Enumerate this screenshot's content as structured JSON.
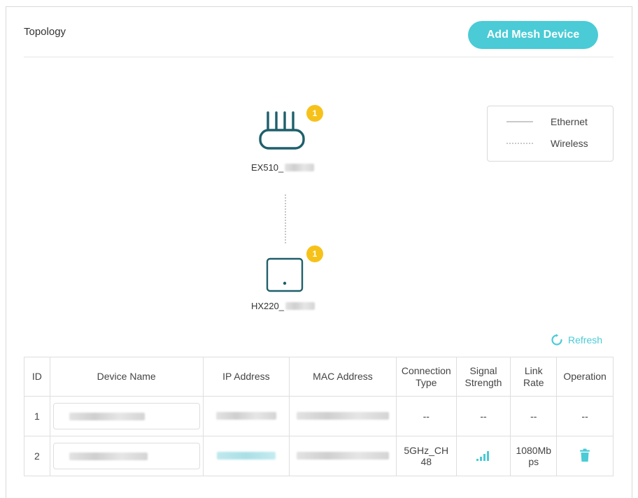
{
  "header": {
    "title": "Topology",
    "add_button": "Add Mesh Device"
  },
  "topology": {
    "main_router": {
      "label": "EX510_",
      "badge": "1"
    },
    "satellite": {
      "label": "HX220_",
      "badge": "1"
    },
    "connection": "wireless"
  },
  "legend": {
    "ethernet": "Ethernet",
    "wireless": "Wireless"
  },
  "refresh_label": "Refresh",
  "table": {
    "headers": {
      "id": "ID",
      "device_name": "Device Name",
      "ip": "IP Address",
      "mac": "MAC Address",
      "conn_type_1": "Connection",
      "conn_type_2": "Type",
      "signal_1": "Signal",
      "signal_2": "Strength",
      "link_1": "Link",
      "link_2": "Rate",
      "operation": "Operation"
    },
    "rows": [
      {
        "id": "1",
        "connection": "--",
        "signal": "--",
        "link_rate": "--",
        "operation": "--"
      },
      {
        "id": "2",
        "connection_1": "5GHz_CH",
        "connection_2": "48",
        "signal": "good",
        "link_rate_1": "1080Mb",
        "link_rate_2": "ps",
        "operation": "delete"
      }
    ]
  },
  "colors": {
    "accent": "#4acbd6",
    "badge": "#f6c21a",
    "device_icon": "#1f5f6b"
  }
}
